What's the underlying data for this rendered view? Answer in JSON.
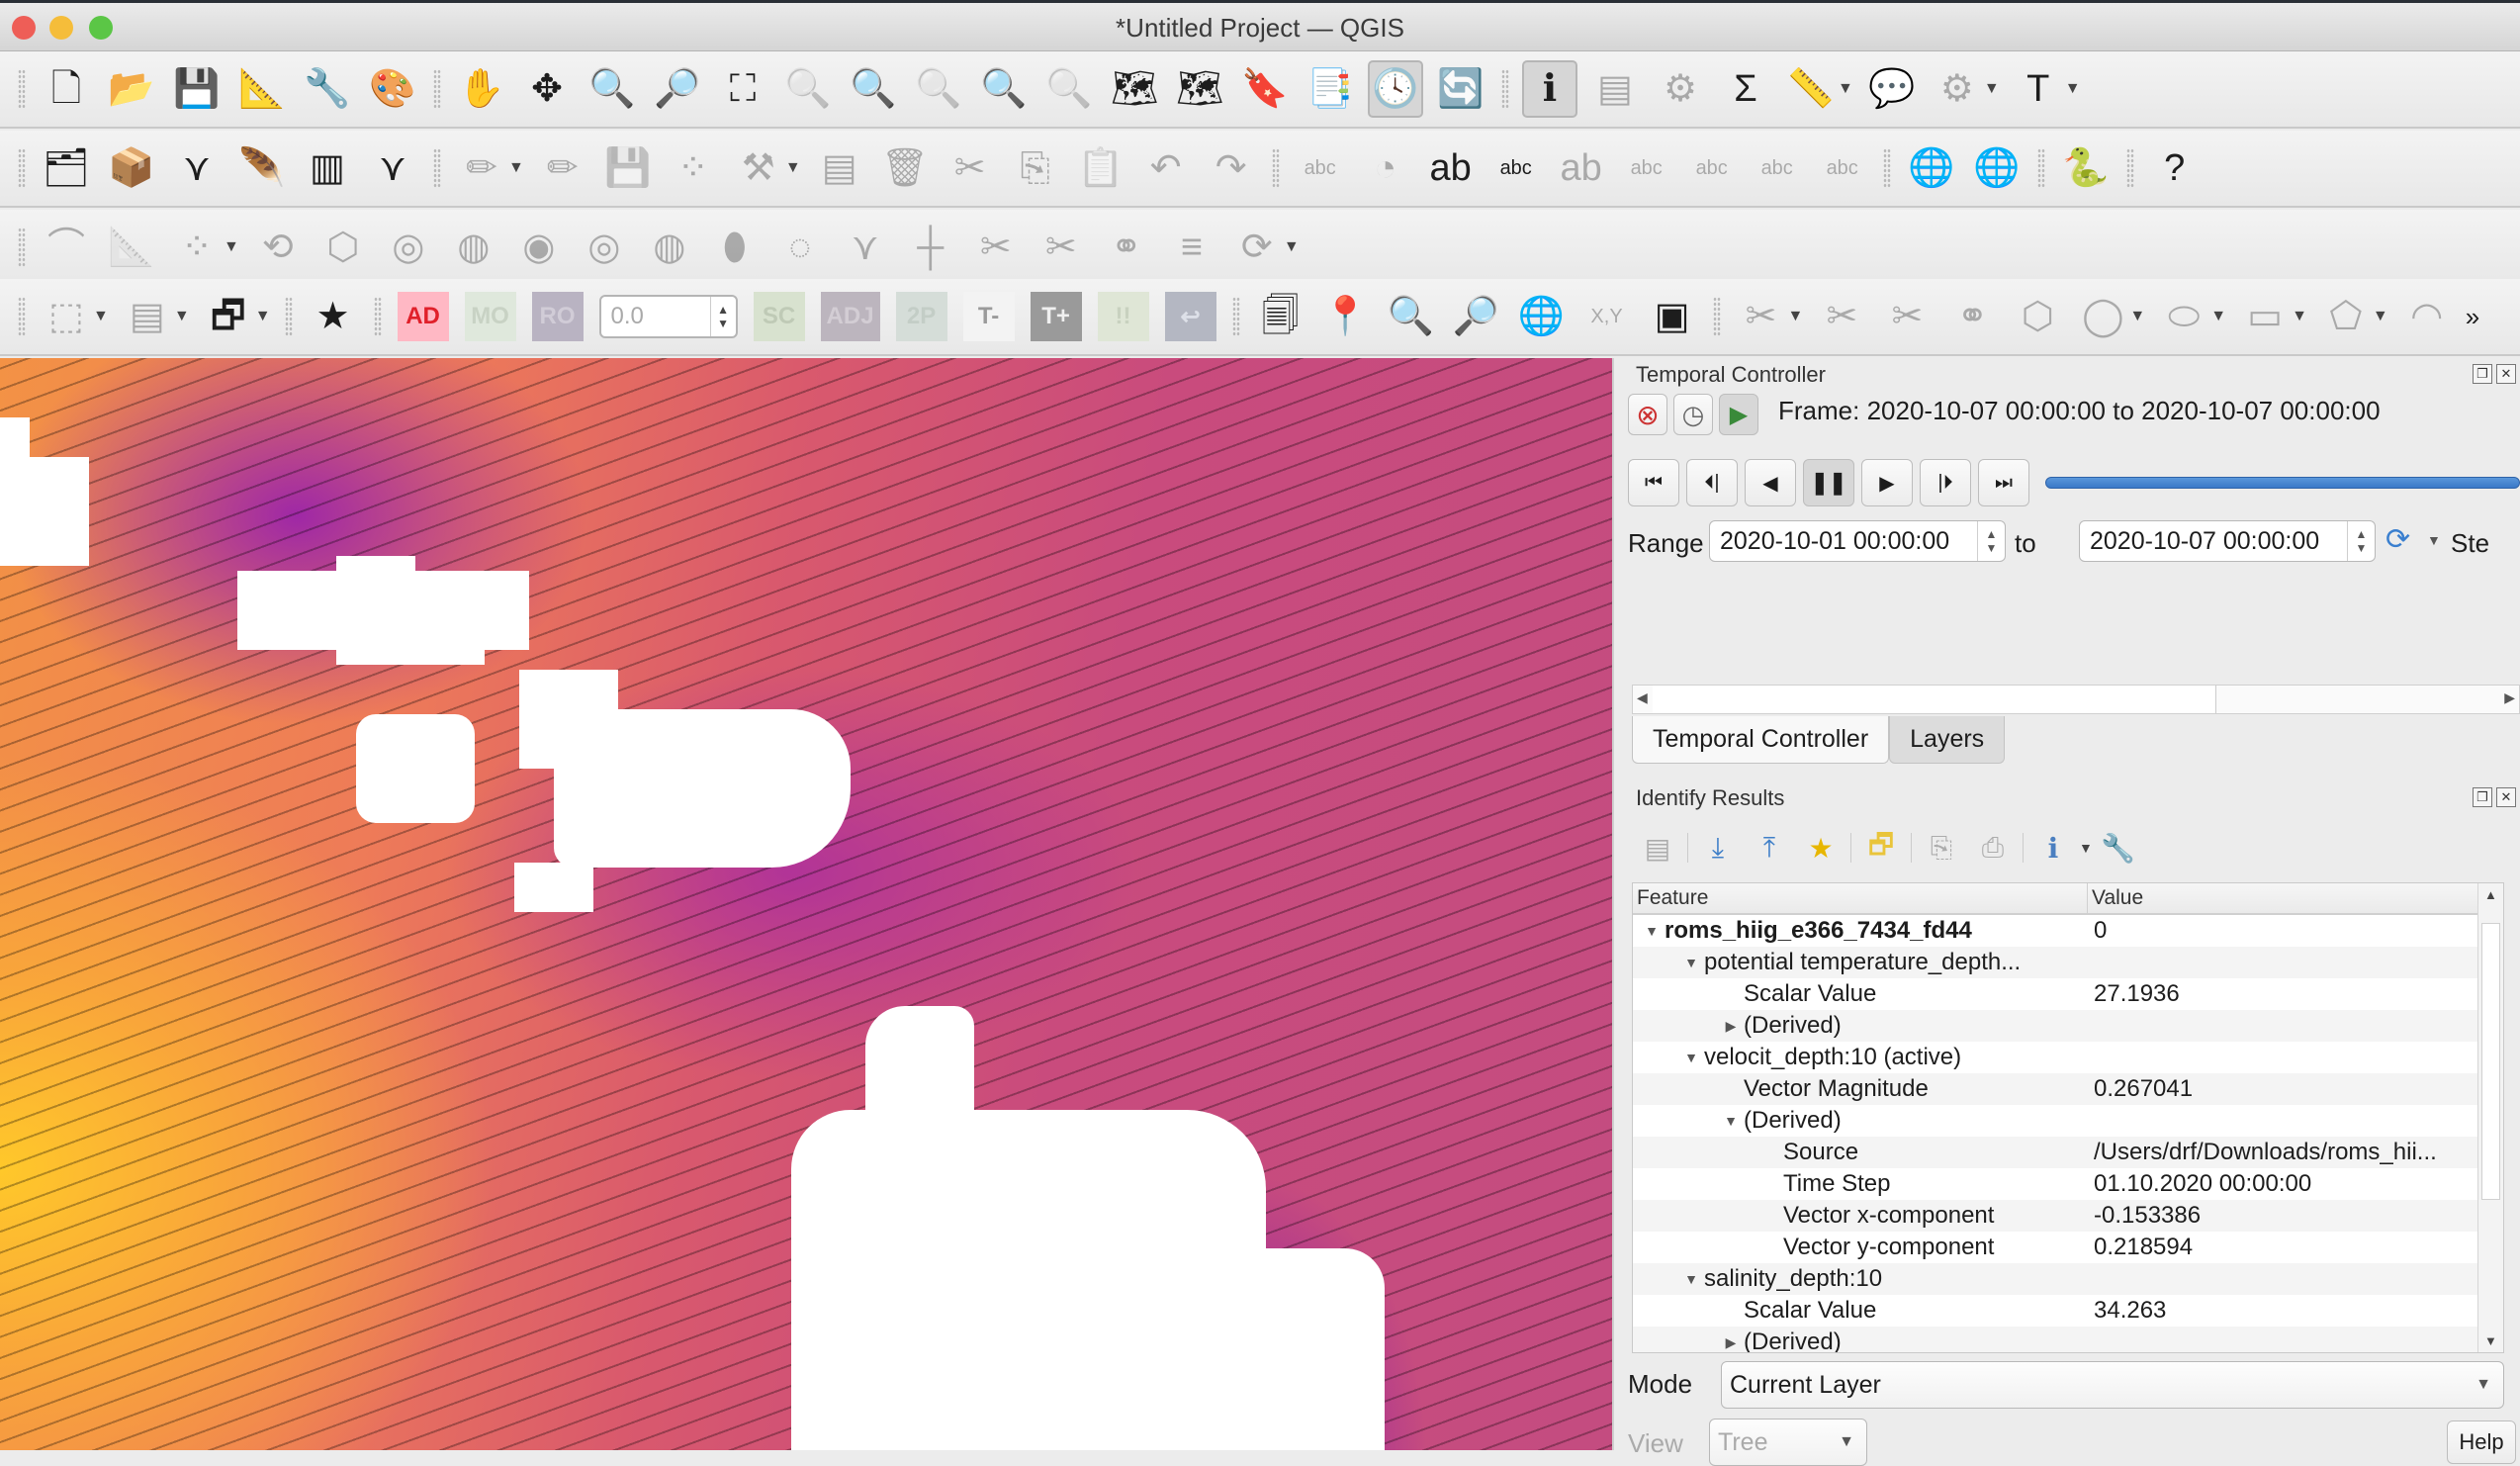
{
  "window": {
    "title": "*Untitled Project — QGIS"
  },
  "toolbars": {
    "row1": [
      {
        "name": "new-project-icon",
        "glyph": "🗋"
      },
      {
        "name": "open-project-icon",
        "glyph": "📂"
      },
      {
        "name": "save-project-icon",
        "glyph": "💾"
      },
      {
        "name": "new-print-layout-icon",
        "glyph": "📐"
      },
      {
        "name": "layout-manager-icon",
        "glyph": "🔧"
      },
      {
        "name": "style-manager-icon",
        "glyph": "🎨"
      },
      {
        "name": "pan-map-icon",
        "glyph": "✋"
      },
      {
        "name": "pan-to-selection-icon",
        "glyph": "✥"
      },
      {
        "name": "zoom-in-icon",
        "glyph": "🔍"
      },
      {
        "name": "zoom-out-icon",
        "glyph": "🔎"
      },
      {
        "name": "zoom-full-icon",
        "glyph": "⛶"
      },
      {
        "name": "zoom-to-selection-icon",
        "glyph": "🔍",
        "dim": true
      },
      {
        "name": "zoom-to-layer-icon",
        "glyph": "🔍"
      },
      {
        "name": "zoom-native-icon",
        "glyph": "🔍",
        "dim": true
      },
      {
        "name": "zoom-last-icon",
        "glyph": "🔍"
      },
      {
        "name": "zoom-next-icon",
        "glyph": "🔍",
        "dim": true
      },
      {
        "name": "new-map-view-icon",
        "glyph": "🗺"
      },
      {
        "name": "new-3d-map-view-icon",
        "glyph": "🗺"
      },
      {
        "name": "new-bookmark-icon",
        "glyph": "🔖"
      },
      {
        "name": "show-bookmarks-icon",
        "glyph": "📑"
      },
      {
        "name": "temporal-controller-icon",
        "glyph": "🕓",
        "active": true
      },
      {
        "name": "refresh-icon",
        "glyph": "🔄"
      },
      {
        "name": "identify-features-icon",
        "glyph": "ℹ",
        "active": true
      },
      {
        "name": "attribute-table-icon",
        "glyph": "▤",
        "dim": true
      },
      {
        "name": "field-calculator-icon",
        "glyph": "⚙",
        "dim": true
      },
      {
        "name": "statistics-icon",
        "glyph": "Σ"
      },
      {
        "name": "measure-icon",
        "glyph": "📏",
        "dropdown": true
      },
      {
        "name": "map-tips-icon",
        "glyph": "💬"
      },
      {
        "name": "run-action-icon",
        "glyph": "⚙",
        "dim": true,
        "dropdown": true
      },
      {
        "name": "text-annotation-icon",
        "glyph": "T",
        "dropdown": true
      }
    ],
    "row2": [
      {
        "name": "data-source-manager-icon",
        "glyph": "🗂"
      },
      {
        "name": "new-geopackage-layer-icon",
        "glyph": "📦"
      },
      {
        "name": "new-shapefile-layer-icon",
        "glyph": "⋎"
      },
      {
        "name": "new-spatialite-layer-icon",
        "glyph": "🪶"
      },
      {
        "name": "new-temporary-layer-icon",
        "glyph": "▥"
      },
      {
        "name": "new-virtual-layer-icon",
        "glyph": "⋎"
      },
      {
        "name": "current-edits-icon",
        "glyph": "✏",
        "dim": true,
        "dropdown": true
      },
      {
        "name": "toggle-editing-icon",
        "glyph": "✏",
        "dim": true
      },
      {
        "name": "save-edits-icon",
        "glyph": "💾",
        "dim": true
      },
      {
        "name": "digitize-icon",
        "glyph": "⁘",
        "dim": true
      },
      {
        "name": "vertex-tool-icon",
        "glyph": "⚒",
        "dim": true,
        "dropdown": true
      },
      {
        "name": "modify-attributes-icon",
        "glyph": "▤",
        "dim": true
      },
      {
        "name": "delete-selected-icon",
        "glyph": "🗑",
        "dim": true
      },
      {
        "name": "cut-features-icon",
        "glyph": "✂",
        "dim": true
      },
      {
        "name": "copy-features-icon",
        "glyph": "⎘",
        "dim": true
      },
      {
        "name": "paste-features-icon",
        "glyph": "📋",
        "dim": true
      },
      {
        "name": "undo-icon",
        "glyph": "↶",
        "dim": true
      },
      {
        "name": "redo-icon",
        "glyph": "↷",
        "dim": true
      },
      {
        "name": "label-toolbar-icon",
        "glyph": "abc",
        "dim": true
      },
      {
        "name": "diagram-icon",
        "glyph": "◔",
        "dim": true
      },
      {
        "name": "pin-labels-icon",
        "glyph": "ab"
      },
      {
        "name": "show-hide-labels-icon",
        "glyph": "abc"
      },
      {
        "name": "move-label-icon",
        "glyph": "ab",
        "dim": true
      },
      {
        "name": "show-hide-label-icon",
        "glyph": "abc",
        "dim": true
      },
      {
        "name": "move-label-arrow-icon",
        "glyph": "abc",
        "dim": true
      },
      {
        "name": "rotate-label-icon",
        "glyph": "abc",
        "dim": true
      },
      {
        "name": "change-label-icon",
        "glyph": "abc",
        "dim": true
      },
      {
        "name": "metasearch-add-icon",
        "glyph": "🌐"
      },
      {
        "name": "metasearch-icon",
        "glyph": "🌐"
      },
      {
        "name": "python-console-icon",
        "glyph": "🐍"
      },
      {
        "name": "help-contents-icon",
        "glyph": "?"
      }
    ],
    "row3": [
      {
        "name": "add-circular-string-icon",
        "glyph": "⌒",
        "dim": true
      },
      {
        "name": "cad-tools-icon",
        "glyph": "📐",
        "dim": true
      },
      {
        "name": "move-feature-icon",
        "glyph": "⁘",
        "dim": true,
        "dropdown": true
      },
      {
        "name": "rotate-feature-icon",
        "glyph": "⟲",
        "dim": true
      },
      {
        "name": "simplify-feature-icon",
        "glyph": "⬡",
        "dim": true
      },
      {
        "name": "add-ring-icon",
        "glyph": "◎",
        "dim": true
      },
      {
        "name": "add-part-icon",
        "glyph": "◍",
        "dim": true
      },
      {
        "name": "fill-ring-icon",
        "glyph": "◉",
        "dim": true
      },
      {
        "name": "delete-ring-icon",
        "glyph": "◎",
        "dim": true
      },
      {
        "name": "delete-part-icon",
        "glyph": "◍",
        "dim": true
      },
      {
        "name": "reshape-features-icon",
        "glyph": "⬮",
        "dim": true
      },
      {
        "name": "offset-curve-icon",
        "glyph": "◌",
        "dim": true
      },
      {
        "name": "reverse-line-icon",
        "glyph": "⋎",
        "dim": true
      },
      {
        "name": "trim-extend-icon",
        "glyph": "┼",
        "dim": true
      },
      {
        "name": "split-features-icon",
        "glyph": "✂",
        "dim": true
      },
      {
        "name": "split-parts-icon",
        "glyph": "✂",
        "dim": true
      },
      {
        "name": "merge-features-icon",
        "glyph": "⚭",
        "dim": true
      },
      {
        "name": "merge-attributes-icon",
        "glyph": "≡",
        "dim": true
      },
      {
        "name": "rotate-point-symbols-icon",
        "glyph": "⟳",
        "dim": true,
        "dropdown": true
      }
    ],
    "row4": {
      "left": [
        {
          "name": "select-features-icon",
          "glyph": "⬚",
          "dim": true,
          "dropdown": true
        },
        {
          "name": "select-by-value-icon",
          "glyph": "▤",
          "dim": true,
          "dropdown": true
        },
        {
          "name": "deselect-all-icon",
          "glyph": "🗗",
          "dropdown": true
        },
        {
          "name": "favorites-icon",
          "glyph": "★"
        }
      ],
      "text_buttons": [
        {
          "name": "ad-button",
          "label": "AD",
          "bg": "#ffb8c4",
          "fg": "#e0202a"
        },
        {
          "name": "mo-button",
          "label": "MO",
          "bg": "#dfe8dc",
          "fg": "#c8d2c4"
        },
        {
          "name": "ro-button",
          "label": "RO",
          "bg": "#b9b3c2",
          "fg": "#d1ccd7"
        }
      ],
      "spin_value": "0.0",
      "text_buttons2": [
        {
          "name": "sc-button",
          "label": "SC",
          "bg": "#d8e2cf",
          "fg": "#bfcab6"
        },
        {
          "name": "adj-button",
          "label": "ADJ",
          "bg": "#bcb5be",
          "fg": "#d3cdd4"
        },
        {
          "name": "2p-button",
          "label": "2P",
          "bg": "#d5ddd8",
          "fg": "#c3cdc6"
        },
        {
          "name": "t-minus-button",
          "label": "T-",
          "bg": "#f3f3f3",
          "fg": "#9a9a9a"
        },
        {
          "name": "t-plus-button",
          "label": "T+",
          "bg": "#9a9a9a",
          "fg": "#f0f0f0"
        },
        {
          "name": "ii-button",
          "label": "!!",
          "bg": "#dfe6d6",
          "fg": "#c8d1bf"
        },
        {
          "name": "back-button",
          "label": "↩",
          "bg": "#b4b7c2",
          "fg": "#dde0e8"
        }
      ],
      "right": [
        {
          "name": "duplicate-geometry-icon",
          "glyph": "🗐"
        },
        {
          "name": "geocode-icon",
          "glyph": "📍"
        },
        {
          "name": "zoom-to-point-icon",
          "glyph": "🔍"
        },
        {
          "name": "zoom-to-points-icon",
          "glyph": "🔎"
        },
        {
          "name": "globe-icon",
          "glyph": "🌐"
        },
        {
          "name": "xy-coordinate-icon",
          "glyph": "X,Y",
          "dim": true
        },
        {
          "name": "georeferencer-icon",
          "glyph": "▣"
        },
        {
          "name": "digitize-shape-1-icon",
          "glyph": "✂",
          "dim": true,
          "dropdown": true
        },
        {
          "name": "digitize-shape-2-icon",
          "glyph": "✂",
          "dim": true
        },
        {
          "name": "split-tool-icon",
          "glyph": "✂",
          "dim": true
        },
        {
          "name": "merge-tool-icon",
          "glyph": "⚭",
          "dim": true
        },
        {
          "name": "polygon-tool-icon",
          "glyph": "⬡",
          "dim": true
        },
        {
          "name": "circle-tool-icon",
          "glyph": "◯",
          "dim": true,
          "dropdown": true
        },
        {
          "name": "ellipse-tool-icon",
          "glyph": "⬭",
          "dim": true,
          "dropdown": true
        },
        {
          "name": "rectangle-tool-icon",
          "glyph": "▭",
          "dim": true,
          "dropdown": true
        },
        {
          "name": "regular-polygon-icon",
          "glyph": "⬠",
          "dim": true,
          "dropdown": true
        },
        {
          "name": "curve-tool-icon",
          "glyph": "◠",
          "dim": true
        }
      ],
      "overflow": "»"
    }
  },
  "temporal": {
    "title": "Temporal Controller",
    "frame_text": "Frame: 2020-10-07 00:00:00 to 2020-10-07 00:00:00",
    "range_label": "Range",
    "range_start": "2020-10-01 00:00:00",
    "to_label": "to",
    "range_end": "2020-10-07 00:00:00",
    "step_label": "Ste",
    "playback_position": 1.0
  },
  "tabs": [
    {
      "label": "Temporal Controller",
      "active": true
    },
    {
      "label": "Layers",
      "active": false
    }
  ],
  "identify": {
    "title": "Identify Results",
    "columns": [
      "Feature",
      "Value"
    ],
    "rows": [
      {
        "indent": 0,
        "toggle": "open",
        "feature": "roms_hiig_e366_7434_fd44",
        "value": "0",
        "bold": true
      },
      {
        "indent": 1,
        "toggle": "open",
        "feature": "potential temperature_depth...",
        "value": ""
      },
      {
        "indent": 2,
        "toggle": "",
        "feature": "Scalar Value",
        "value": "27.1936"
      },
      {
        "indent": 2,
        "toggle": "closed",
        "feature": "(Derived)",
        "value": ""
      },
      {
        "indent": 1,
        "toggle": "open",
        "feature": "velocit_depth:10 (active)",
        "value": ""
      },
      {
        "indent": 2,
        "toggle": "",
        "feature": "Vector Magnitude",
        "value": "0.267041"
      },
      {
        "indent": 2,
        "toggle": "open",
        "feature": "(Derived)",
        "value": ""
      },
      {
        "indent": 3,
        "toggle": "",
        "feature": "Source",
        "value": "/Users/drf/Downloads/roms_hii..."
      },
      {
        "indent": 3,
        "toggle": "",
        "feature": "Time Step",
        "value": "01.10.2020 00:00:00"
      },
      {
        "indent": 3,
        "toggle": "",
        "feature": "Vector x-component",
        "value": "-0.153386"
      },
      {
        "indent": 3,
        "toggle": "",
        "feature": "Vector y-component",
        "value": "0.218594"
      },
      {
        "indent": 1,
        "toggle": "open",
        "feature": "salinity_depth:10",
        "value": ""
      },
      {
        "indent": 2,
        "toggle": "",
        "feature": "Scalar Value",
        "value": "34.263"
      },
      {
        "indent": 2,
        "toggle": "closed",
        "feature": "(Derived)",
        "value": ""
      }
    ],
    "mode_label": "Mode",
    "mode_value": "Current Layer",
    "view_label": "View",
    "view_value": "Tree",
    "help_label": "Help"
  }
}
